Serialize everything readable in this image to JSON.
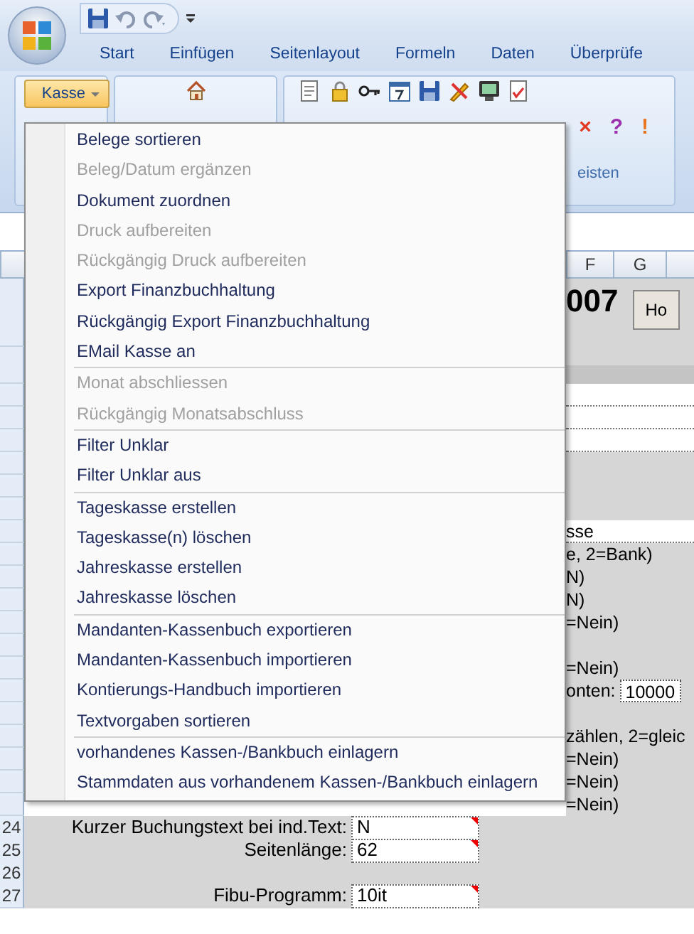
{
  "tabs": [
    "Start",
    "Einfügen",
    "Seitenlayout",
    "Formeln",
    "Daten",
    "Überprüfe"
  ],
  "ribbon": {
    "menu_button": {
      "label": "Kasse",
      "pressed": true
    },
    "group_label": "eisten",
    "symbols": [
      {
        "char": "×",
        "color": "#e23a22"
      },
      {
        "char": "?",
        "color": "#9b2fae"
      },
      {
        "char": "!",
        "color": "#e8731c"
      }
    ]
  },
  "columns": [
    "F",
    "G"
  ],
  "sheet_rows": [
    {
      "kind": "heading",
      "text": "007",
      "button": "Ho"
    },
    {
      "kind": "band"
    },
    {
      "kind": "field"
    },
    {
      "kind": "field"
    },
    {
      "kind": "field"
    },
    {
      "kind": "blank"
    },
    {
      "kind": "blank"
    },
    {
      "kind": "blank"
    },
    {
      "kind": "field",
      "text": "sse"
    },
    {
      "kind": "text",
      "text": "e, 2=Bank)"
    },
    {
      "kind": "text",
      "text": "N)"
    },
    {
      "kind": "text",
      "text": "N)"
    },
    {
      "kind": "text",
      "text": "=Nein)"
    },
    {
      "kind": "blank"
    },
    {
      "kind": "text",
      "text": "=Nein)"
    },
    {
      "kind": "labelfield",
      "text": "onten:",
      "value": "10000"
    },
    {
      "kind": "blank"
    },
    {
      "kind": "text",
      "text": "zählen, 2=gleic"
    },
    {
      "kind": "text",
      "text": "=Nein)"
    },
    {
      "kind": "text",
      "text": "=Nein)"
    },
    {
      "kind": "text",
      "text": "=Nein)"
    }
  ],
  "form_rows": [
    {
      "number": "24",
      "label": "Kurzer Buchungstext bei ind.Text:",
      "value": "N"
    },
    {
      "number": "25",
      "label": "Seitenlänge:",
      "value": "62"
    },
    {
      "number": "26"
    },
    {
      "number": "27",
      "label": "Fibu-Programm:",
      "value": "10it"
    }
  ],
  "menu": [
    [
      {
        "label": "Belege sortieren",
        "disabled": false
      },
      {
        "label": "Beleg/Datum ergänzen",
        "disabled": true
      },
      {
        "label": "Dokument zuordnen",
        "disabled": false
      },
      {
        "label": "Druck aufbereiten",
        "disabled": true
      },
      {
        "label": "Rückgängig Druck aufbereiten",
        "disabled": true
      },
      {
        "label": "Export Finanzbuchhaltung",
        "disabled": false
      },
      {
        "label": "Rückgängig Export Finanzbuchhaltung",
        "disabled": false
      },
      {
        "label": "EMail Kasse an",
        "disabled": false
      }
    ],
    [
      {
        "label": "Monat abschliessen",
        "disabled": true
      },
      {
        "label": "Rückgängig Monatsabschluss",
        "disabled": true
      }
    ],
    [
      {
        "label": "Filter Unklar",
        "disabled": false
      },
      {
        "label": "Filter Unklar aus",
        "disabled": false
      }
    ],
    [
      {
        "label": "Tageskasse erstellen",
        "disabled": false
      },
      {
        "label": "Tageskasse(n) löschen",
        "disabled": false
      },
      {
        "label": "Jahreskasse erstellen",
        "disabled": false
      },
      {
        "label": "Jahreskasse löschen",
        "disabled": false
      }
    ],
    [
      {
        "label": "Mandanten-Kassenbuch exportieren",
        "disabled": false
      },
      {
        "label": "Mandanten-Kassenbuch importieren",
        "disabled": false
      },
      {
        "label": "Kontierungs-Handbuch importieren",
        "disabled": false
      },
      {
        "label": "Textvorgaben sortieren",
        "disabled": false
      }
    ],
    [
      {
        "label": "vorhandenes Kassen-/Bankbuch einlagern",
        "disabled": false
      },
      {
        "label": "Stammdaten aus vorhandenem Kassen-/Bankbuch einlagern",
        "disabled": false
      }
    ]
  ]
}
